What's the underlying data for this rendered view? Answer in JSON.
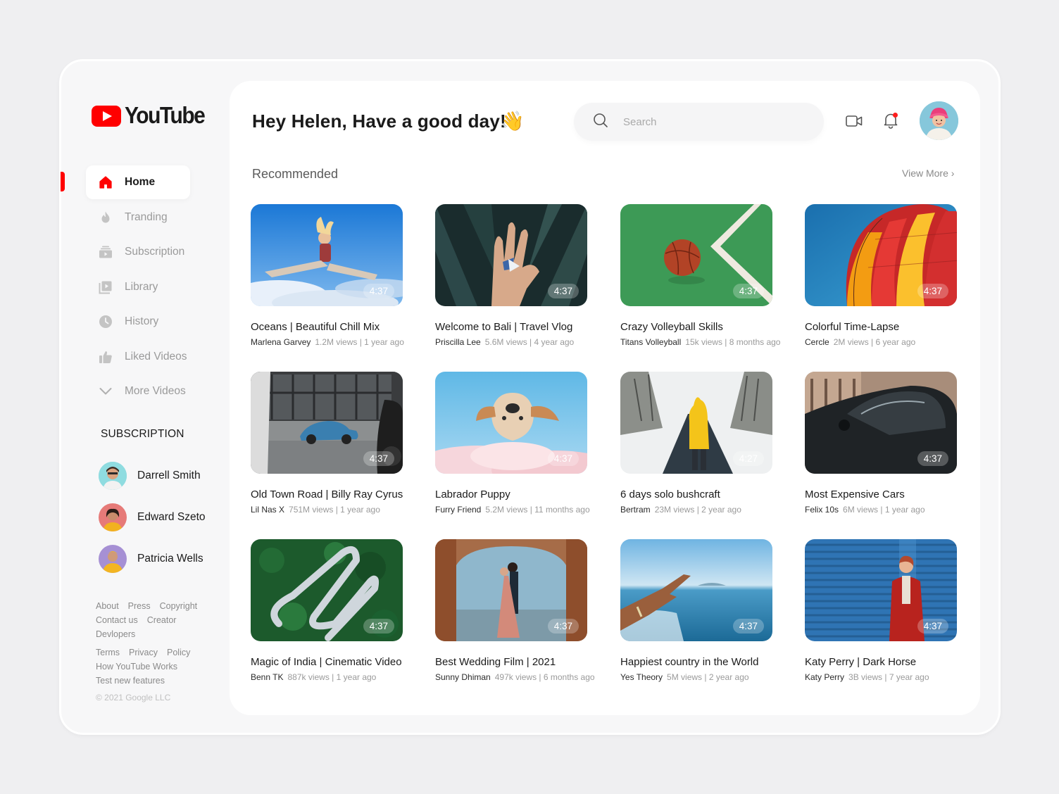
{
  "brand": {
    "name": "YouTube",
    "color": "#ff0000"
  },
  "nav": {
    "items": [
      {
        "label": "Home",
        "icon": "home-icon",
        "active": true
      },
      {
        "label": "Tranding",
        "icon": "fire-icon"
      },
      {
        "label": "Subscription",
        "icon": "subscription-icon"
      },
      {
        "label": "Library",
        "icon": "library-icon"
      },
      {
        "label": "History",
        "icon": "clock-icon"
      },
      {
        "label": "Liked Videos",
        "icon": "thumbs-up-icon"
      },
      {
        "label": "More Videos",
        "icon": "chevron-down-icon"
      }
    ]
  },
  "subscriptions": {
    "title": "SUBSCRIPTION",
    "channels": [
      {
        "name": "Darrell Smith"
      },
      {
        "name": "Edward Szeto"
      },
      {
        "name": "Patricia Wells"
      }
    ]
  },
  "footer": {
    "links_1": [
      "About",
      "Press",
      "Copyright",
      "Contact us",
      "Creator",
      "Devlopers"
    ],
    "links_2": [
      "Terms",
      "Privacy",
      "Policy",
      "How YouTube Works",
      "Test new features"
    ],
    "copyright": "© 2021 Google LLC"
  },
  "header": {
    "greeting": "Hey Helen, Have a good day!",
    "wave_emoji": "👋",
    "search_placeholder": "Search",
    "icons": [
      "video-camera-icon",
      "bell-icon",
      "avatar"
    ],
    "notification_dot_color": "#ff1e1e"
  },
  "recommended": {
    "title": "Recommended",
    "view_more": "View More",
    "videos": [
      {
        "title": "Oceans | Beautiful Chill Mix",
        "channel": "Marlena Garvey",
        "stats": "1.2M views | 1 year ago",
        "duration": "4:37"
      },
      {
        "title": "Welcome to Bali | Travel Vlog",
        "channel": "Priscilla Lee",
        "stats": "5.6M views | 4 year ago",
        "duration": "4:37"
      },
      {
        "title": "Crazy Volleyball Skills",
        "channel": "Titans Volleyball",
        "stats": "15k views | 8 months ago",
        "duration": "4:37"
      },
      {
        "title": "Colorful Time-Lapse",
        "channel": "Cercle",
        "stats": "2M views | 6 year ago",
        "duration": "4:37"
      },
      {
        "title": "Old Town Road | Billy Ray Cyrus",
        "channel": "Lil Nas X",
        "stats": "751M views | 1 year ago",
        "duration": "4:37"
      },
      {
        "title": "Labrador Puppy",
        "channel": "Furry Friend",
        "stats": "5.2M views | 11 months ago",
        "duration": "4:37"
      },
      {
        "title": "6 days solo bushcraft",
        "channel": "Bertram",
        "stats": "23M views | 2 year ago",
        "duration": "4:27"
      },
      {
        "title": "Most Expensive Cars",
        "channel": "Felix 10s",
        "stats": "6M views | 1 year ago",
        "duration": "4:37"
      },
      {
        "title": "Magic of India | Cinematic Video",
        "channel": "Benn TK",
        "stats": "887k views | 1 year ago",
        "duration": "4:37"
      },
      {
        "title": "Best Wedding Film | 2021",
        "channel": "Sunny Dhiman",
        "stats": "497k views | 6 months ago",
        "duration": "4:37"
      },
      {
        "title": "Happiest country in the World",
        "channel": "Yes Theory",
        "stats": "5M views | 2 year ago",
        "duration": "4:37"
      },
      {
        "title": "Katy Perry | Dark Horse",
        "channel": "Katy Perry",
        "stats": "3B views | 7 year ago",
        "duration": "4:37"
      }
    ]
  }
}
